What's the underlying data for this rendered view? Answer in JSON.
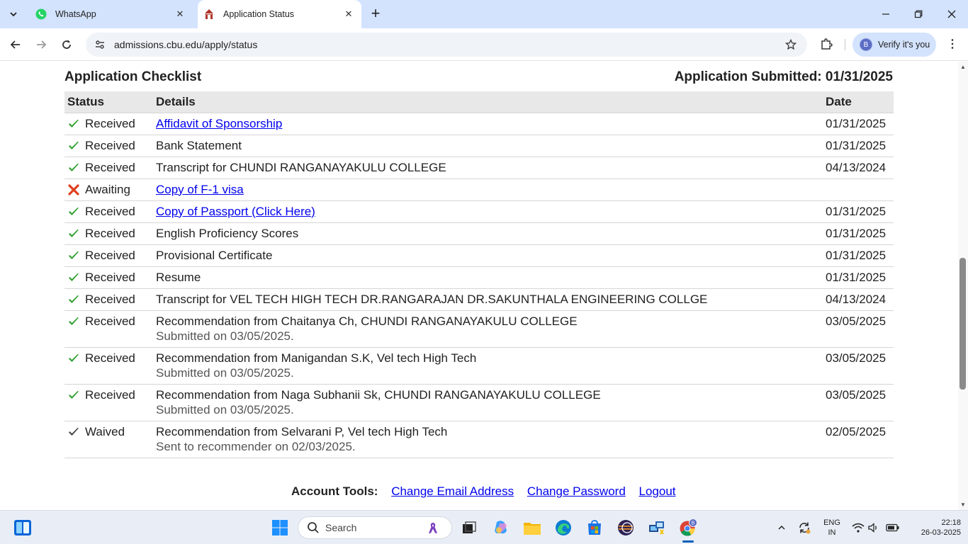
{
  "browser": {
    "tabs": [
      {
        "title": "WhatsApp",
        "active": false,
        "icon": "whatsapp-icon"
      },
      {
        "title": "Application Status",
        "active": true,
        "icon": "cbu-favicon"
      }
    ],
    "url": "admissions.cbu.edu/apply/status",
    "verify_label": "Verify it's you",
    "avatar_letter": "B"
  },
  "page": {
    "checklist_title": "Application Checklist",
    "submitted_label": "Application Submitted: 01/31/2025",
    "table": {
      "headers": {
        "status": "Status",
        "details": "Details",
        "date": "Date"
      },
      "rows": [
        {
          "status": "Received",
          "icon": "check-icon",
          "details": "Affidavit of Sponsorship",
          "link": true,
          "note": "",
          "date": "01/31/2025"
        },
        {
          "status": "Received",
          "icon": "check-icon",
          "details": "Bank Statement",
          "link": false,
          "note": "",
          "date": "01/31/2025"
        },
        {
          "status": "Received",
          "icon": "check-icon",
          "details": "Transcript for CHUNDI RANGANAYAKULU COLLEGE",
          "link": false,
          "note": "",
          "date": "04/13/2024"
        },
        {
          "status": "Awaiting",
          "icon": "x-icon",
          "details": "Copy of F-1 visa",
          "link": true,
          "note": "",
          "date": ""
        },
        {
          "status": "Received",
          "icon": "check-icon",
          "details": "Copy of Passport (Click Here)",
          "link": true,
          "note": "",
          "date": "01/31/2025"
        },
        {
          "status": "Received",
          "icon": "check-icon",
          "details": "English Proficiency Scores",
          "link": false,
          "note": "",
          "date": "01/31/2025"
        },
        {
          "status": "Received",
          "icon": "check-icon",
          "details": "Provisional Certificate",
          "link": false,
          "note": "",
          "date": "01/31/2025"
        },
        {
          "status": "Received",
          "icon": "check-icon",
          "details": "Resume",
          "link": false,
          "note": "",
          "date": "01/31/2025"
        },
        {
          "status": "Received",
          "icon": "check-icon",
          "details": "Transcript for VEL TECH HIGH TECH DR.RANGARAJAN DR.SAKUNTHALA ENGINEERING COLLGE",
          "link": false,
          "note": "",
          "date": "04/13/2024"
        },
        {
          "status": "Received",
          "icon": "check-icon",
          "details": "Recommendation from Chaitanya Ch, CHUNDI RANGANAYAKULU COLLEGE",
          "link": false,
          "note": "Submitted on 03/05/2025.",
          "date": "03/05/2025"
        },
        {
          "status": "Received",
          "icon": "check-icon",
          "details": "Recommendation from Manigandan S.K, Vel tech High Tech",
          "link": false,
          "note": "Submitted on 03/05/2025.",
          "date": "03/05/2025"
        },
        {
          "status": "Received",
          "icon": "check-icon",
          "details": "Recommendation from Naga Subhanii Sk, CHUNDI RANGANAYAKULU COLLEGE",
          "link": false,
          "note": "Submitted on 03/05/2025.",
          "date": "03/05/2025"
        },
        {
          "status": "Waived",
          "icon": "waived-check-icon",
          "details": "Recommendation from Selvarani P, Vel tech High Tech",
          "link": false,
          "note": "Sent to recommender on 02/03/2025.",
          "date": "02/05/2025"
        }
      ]
    },
    "account_tools": {
      "label": "Account Tools:",
      "links": [
        "Change Email Address",
        "Change Password",
        "Logout"
      ]
    }
  },
  "taskbar": {
    "search_placeholder": "Search",
    "lang_top": "ENG",
    "lang_bottom": "IN",
    "time": "22:18",
    "date": "26-03-2025"
  },
  "colors": {
    "check_green": "#2e9e2e",
    "x_red": "#e0401f",
    "link_blue": "#0000ee",
    "tab_strip": "#d3e3fd"
  }
}
